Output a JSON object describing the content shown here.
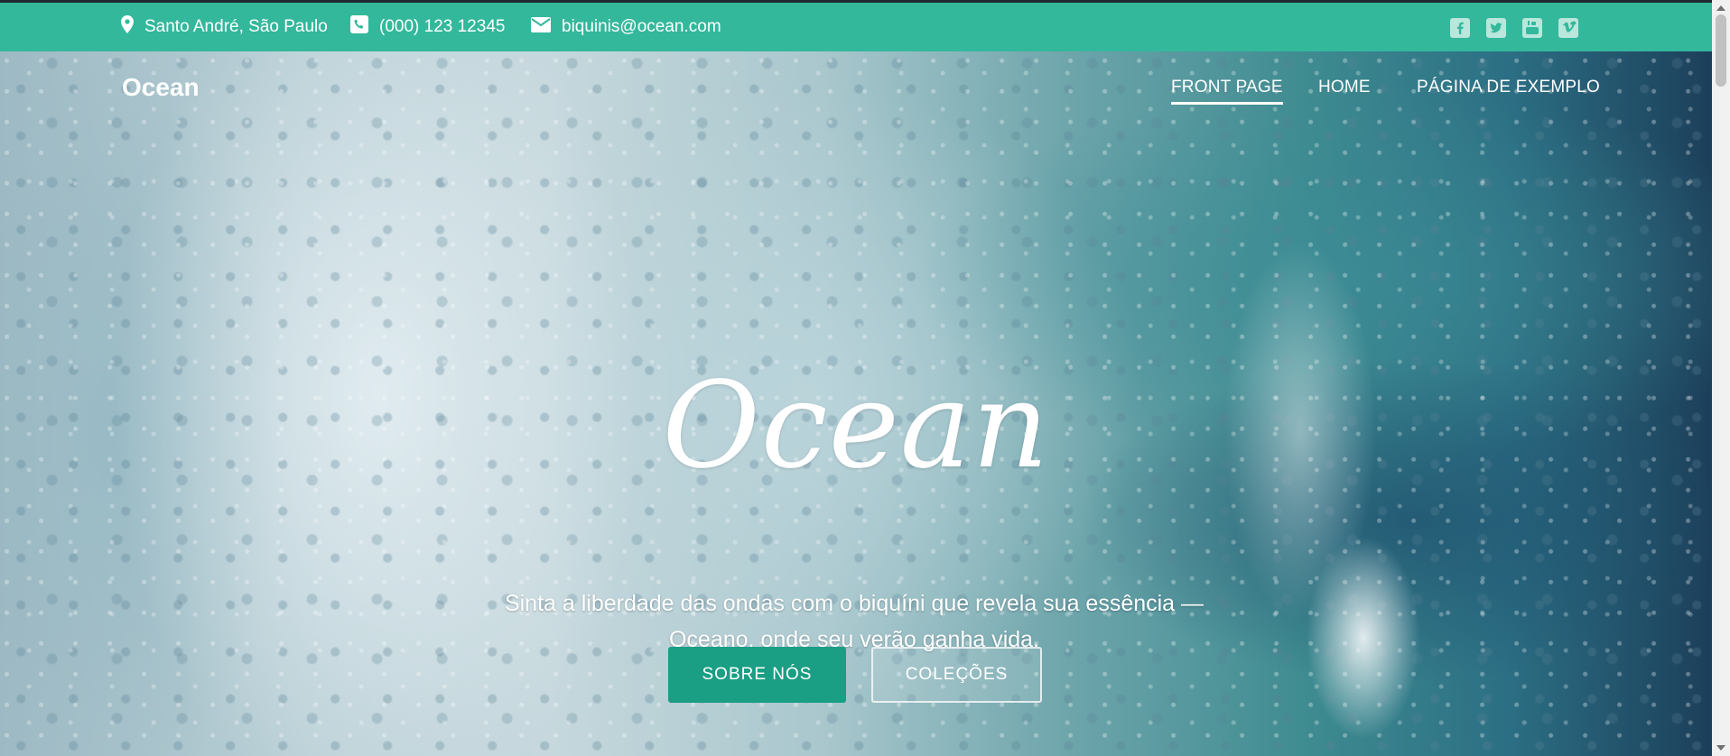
{
  "topbar": {
    "location": "Santo André, São Paulo",
    "phone": "(000) 123 12345",
    "email": "biquinis@ocean.com",
    "social": [
      "facebook-icon",
      "twitter-icon",
      "youtube-icon",
      "vimeo-icon"
    ],
    "background": "#33b89c"
  },
  "header": {
    "logo": "Ocean",
    "nav": [
      {
        "label": "FRONT PAGE",
        "active": true
      },
      {
        "label": "HOME",
        "active": false
      },
      {
        "label": "PÁGINA DE EXEMPLO",
        "active": false
      }
    ]
  },
  "hero": {
    "title": "Ocean",
    "subtitle_line1": "Sinta a liberdade das ondas com o biquíni que revela sua essência —",
    "subtitle_line2": "Oceano, onde seu verão ganha vida.",
    "primary_button": "SOBRE NÓS",
    "secondary_button": "COLEÇÕES",
    "accent": "#1a9e84"
  }
}
